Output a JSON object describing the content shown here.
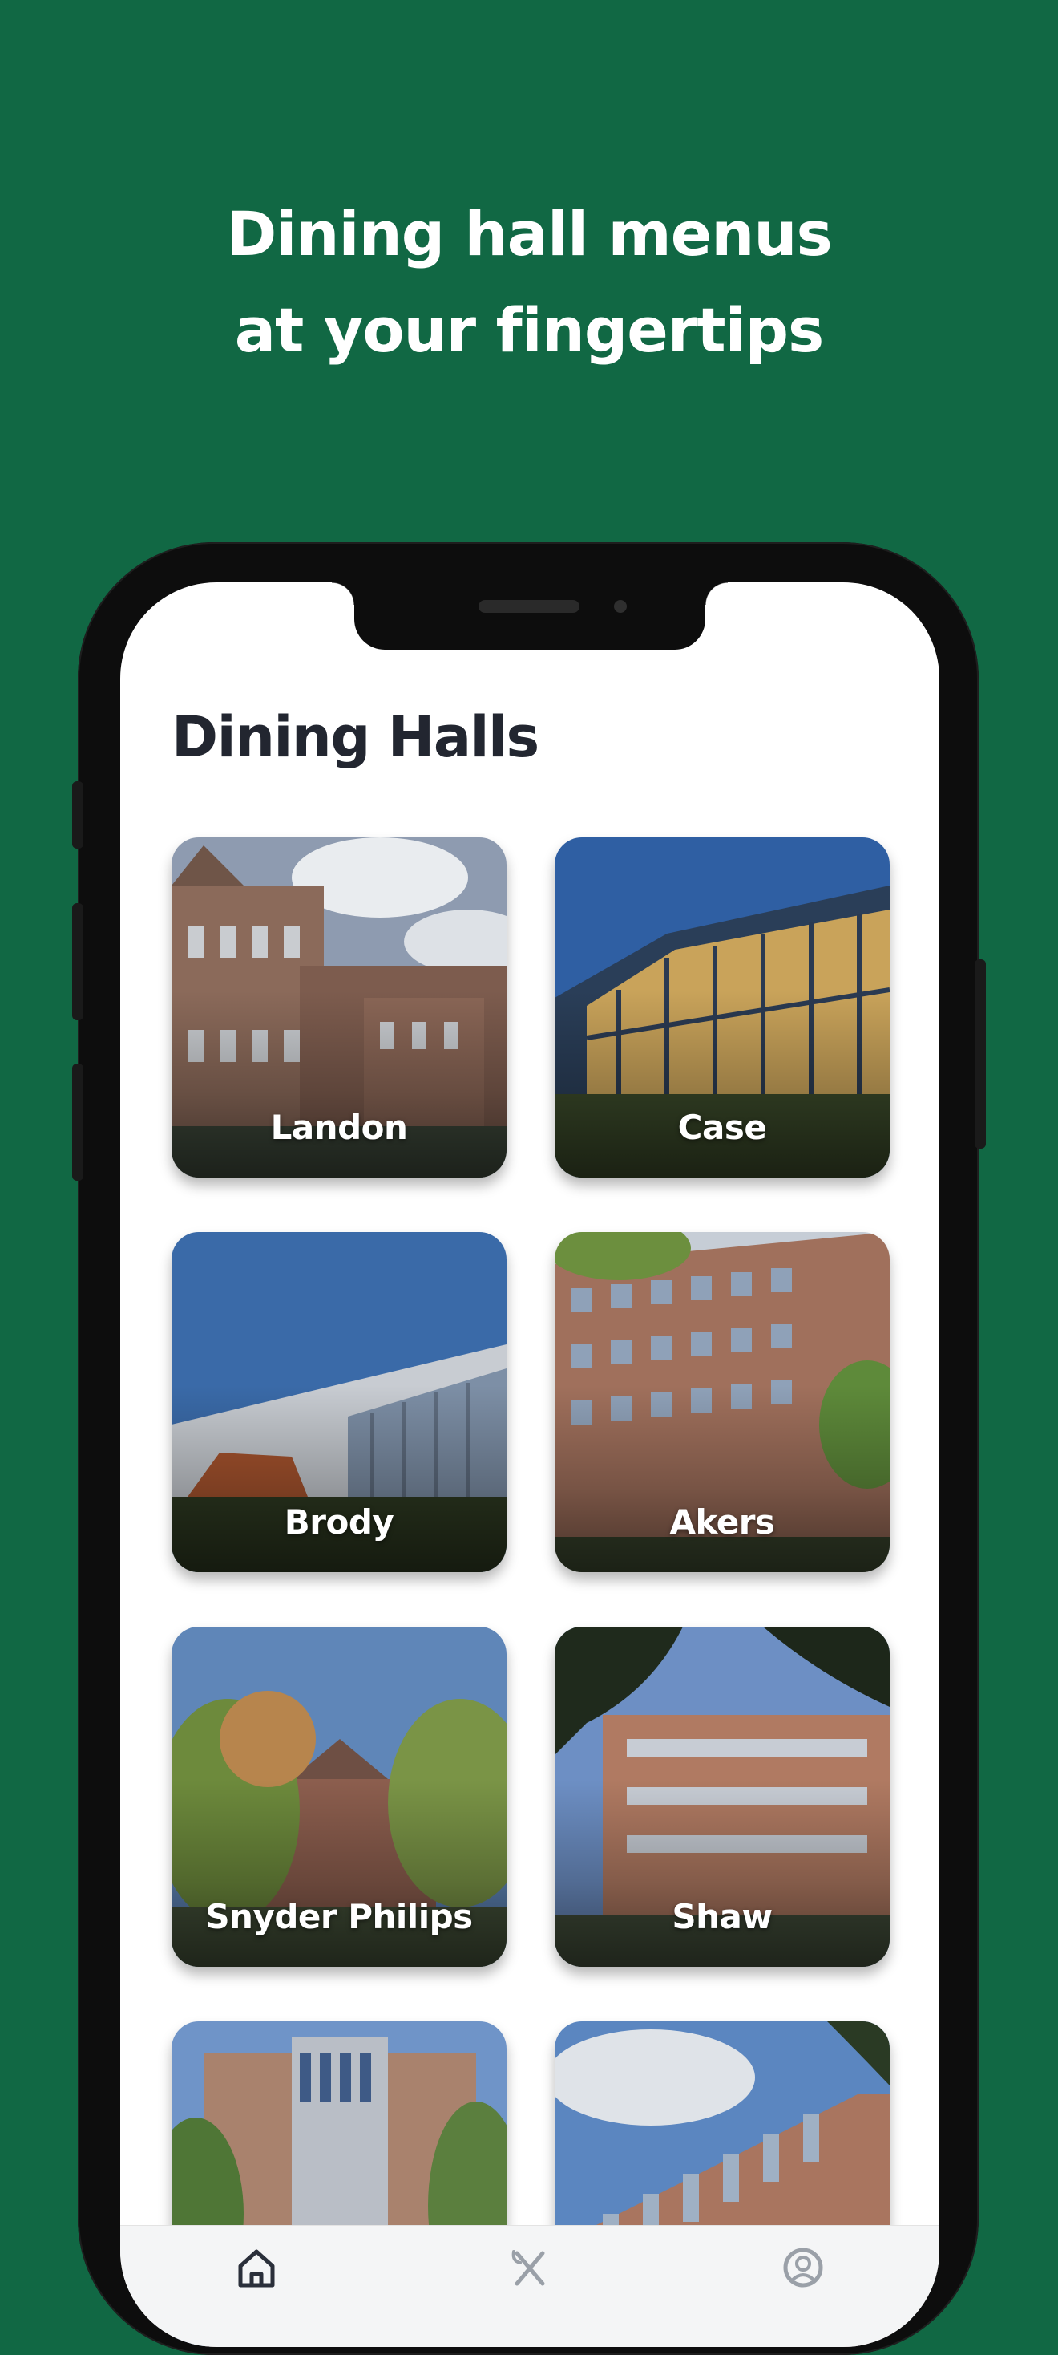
{
  "headline": {
    "line1": "Dining hall menus",
    "line2": "at your fingertips"
  },
  "screen": {
    "title": "Dining Halls"
  },
  "dining_halls": [
    {
      "name": "Landon"
    },
    {
      "name": "Case"
    },
    {
      "name": "Brody"
    },
    {
      "name": "Akers"
    },
    {
      "name": "Snyder Philips"
    },
    {
      "name": "Shaw"
    },
    {
      "name": ""
    },
    {
      "name": ""
    }
  ],
  "tabbar": {
    "items": [
      {
        "icon": "home-icon",
        "active": true
      },
      {
        "icon": "fork-knife-icon",
        "active": false
      },
      {
        "icon": "profile-icon",
        "active": false
      }
    ]
  },
  "colors": {
    "background": "#116844",
    "title_text": "#222630",
    "tabbar": "#f4f5f6"
  }
}
